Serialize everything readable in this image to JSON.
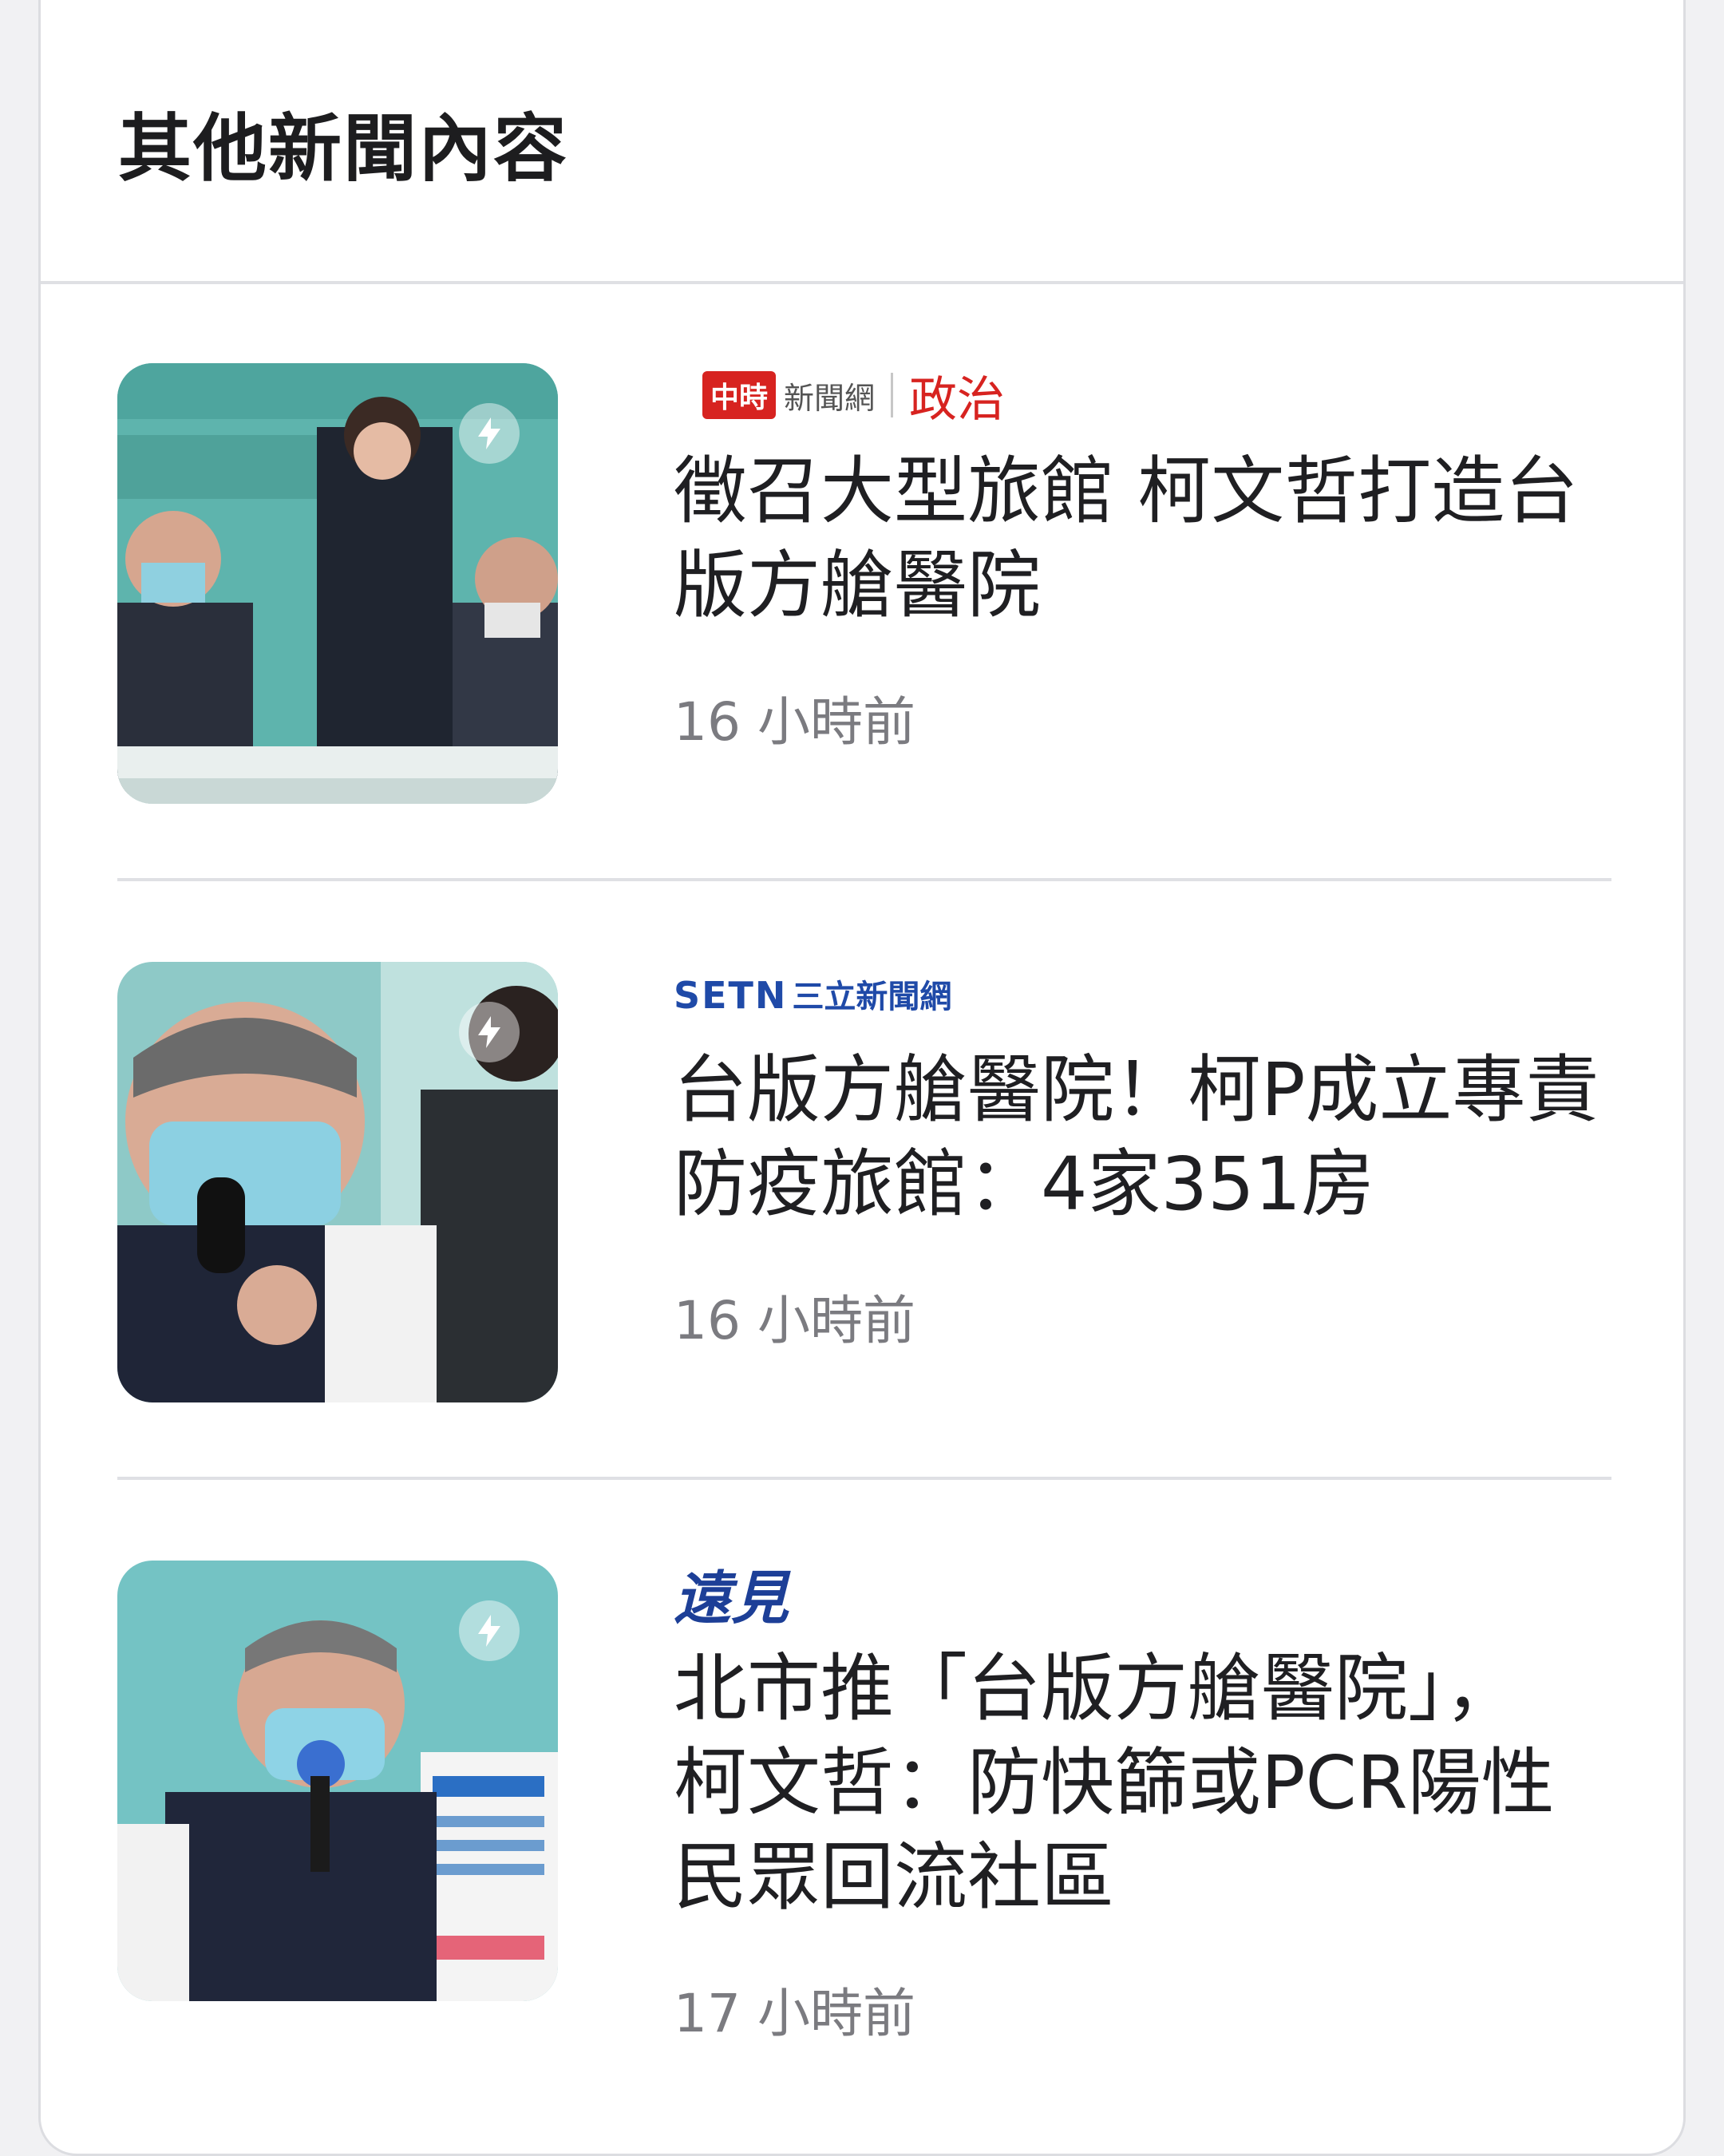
{
  "section": {
    "title": "其他新聞內容"
  },
  "articles": [
    {
      "source_logo": "中時",
      "source_name": "新聞網",
      "category": "政治",
      "headline_line1": "徵召大型旅館 柯文哲打造台",
      "headline_line2": "版方艙醫院",
      "time": "16 小時前"
    },
    {
      "source_logo": "SETN",
      "source_name": "三立新聞網",
      "headline_line1": "台版方艙醫院！柯P成立專責",
      "headline_line2": "防疫旅館：4家351房",
      "time": "16 小時前"
    },
    {
      "source_logo": "遠見",
      "headline_line1": "北市推「台版方艙醫院」，",
      "headline_line2": "柯文哲：防快篩或PCR陽性",
      "headline_line3": "民眾回流社區",
      "time": "17 小時前"
    }
  ],
  "icons": {
    "flash": "lightning-bolt-icon"
  },
  "colors": {
    "accent_red": "#d72320",
    "setn_blue": "#1f4aa8",
    "gvm_blue": "#1d3f97",
    "thumb_teal": "#5eb4ad"
  }
}
